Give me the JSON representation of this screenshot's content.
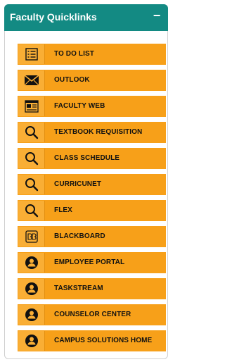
{
  "header": {
    "title": "Faculty Quicklinks",
    "collapse_symbol": "−"
  },
  "colors": {
    "header_bg": "#138a83",
    "item_bg": "#f7a019",
    "icon_bg": "#f9ae35",
    "text": "#111111"
  },
  "links": [
    {
      "label": "TO DO LIST",
      "icon": "checklist-icon"
    },
    {
      "label": "OUTLOOK",
      "icon": "envelope-icon"
    },
    {
      "label": "FACULTY WEB",
      "icon": "web-page-icon"
    },
    {
      "label": "TEXTBOOK REQUISITION",
      "icon": "search-icon"
    },
    {
      "label": "CLASS SCHEDULE",
      "icon": "search-icon"
    },
    {
      "label": "CURRICUNET",
      "icon": "search-icon"
    },
    {
      "label": "FLEX",
      "icon": "search-icon"
    },
    {
      "label": "BLACKBOARD",
      "icon": "blackboard-bb-icon"
    },
    {
      "label": "EMPLOYEE PORTAL",
      "icon": "user-circle-icon"
    },
    {
      "label": "TASKSTREAM",
      "icon": "user-circle-icon"
    },
    {
      "label": "COUNSELOR CENTER",
      "icon": "user-circle-icon"
    },
    {
      "label": "CAMPUS SOLUTIONS HOME",
      "icon": "user-circle-icon"
    }
  ]
}
